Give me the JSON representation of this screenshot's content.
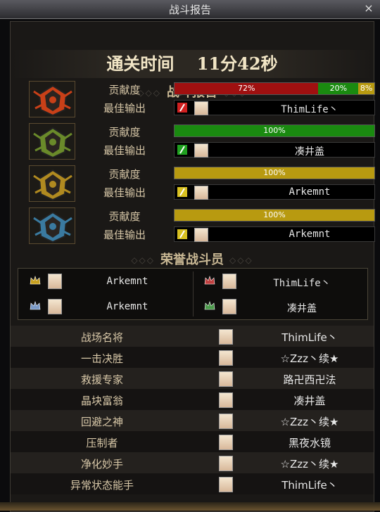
{
  "window": {
    "title": "战斗报告",
    "close_label": "×"
  },
  "clear_time": {
    "label": "通关时间",
    "value": "11分42秒"
  },
  "battle_report_title": "战斗报告",
  "contribution_label": "贡献度",
  "best_output_label": "最佳输出",
  "players": [
    {
      "helmet_color": "#c84018",
      "contribution": [
        {
          "text": "72%",
          "pct": 72,
          "color": "#a01010"
        },
        {
          "text": "20%",
          "pct": 20,
          "color": "#1a8a10"
        },
        {
          "text": "8%",
          "pct": 8,
          "color": "#b89a10"
        }
      ],
      "best_class_color": "#d02020",
      "best_name": "ThimLife丶"
    },
    {
      "helmet_color": "#6a8a2a",
      "contribution": [
        {
          "text": "100%",
          "pct": 100,
          "color": "#1a8a10"
        }
      ],
      "best_class_color": "#20a020",
      "best_name": "凑井盖"
    },
    {
      "helmet_color": "#b08a20",
      "contribution": [
        {
          "text": "100%",
          "pct": 100,
          "color": "#b89a10"
        }
      ],
      "best_class_color": "#d8c020",
      "best_name": "Arkemnt"
    },
    {
      "helmet_color": "#3a7aa0",
      "contribution": [
        {
          "text": "100%",
          "pct": 100,
          "color": "#b89a10"
        }
      ],
      "best_class_color": "#d8c020",
      "best_name": "Arkemnt"
    }
  ],
  "honor_title": "荣誉战斗员",
  "honor": [
    {
      "name": "Arkemnt",
      "crown_color": "#c8a020"
    },
    {
      "name": "ThimLife丶",
      "crown_color": "#c04040"
    },
    {
      "name": "Arkemnt",
      "crown_color": "#7a9ac8"
    },
    {
      "name": "凑井盖",
      "crown_color": "#4a9a4a"
    }
  ],
  "awards": [
    {
      "title": "战场名将",
      "player": "ThimLife丶"
    },
    {
      "title": "一击决胜",
      "player": "☆Zzz丶续★"
    },
    {
      "title": "救援专家",
      "player": "路卍西卍法"
    },
    {
      "title": "晶块富翁",
      "player": "凑井盖"
    },
    {
      "title": "回避之神",
      "player": "☆Zzz丶续★"
    },
    {
      "title": "压制者",
      "player": "黑夜水镜"
    },
    {
      "title": "净化妙手",
      "player": "☆Zzz丶续★"
    },
    {
      "title": "异常状态能手",
      "player": "ThimLife丶"
    }
  ]
}
